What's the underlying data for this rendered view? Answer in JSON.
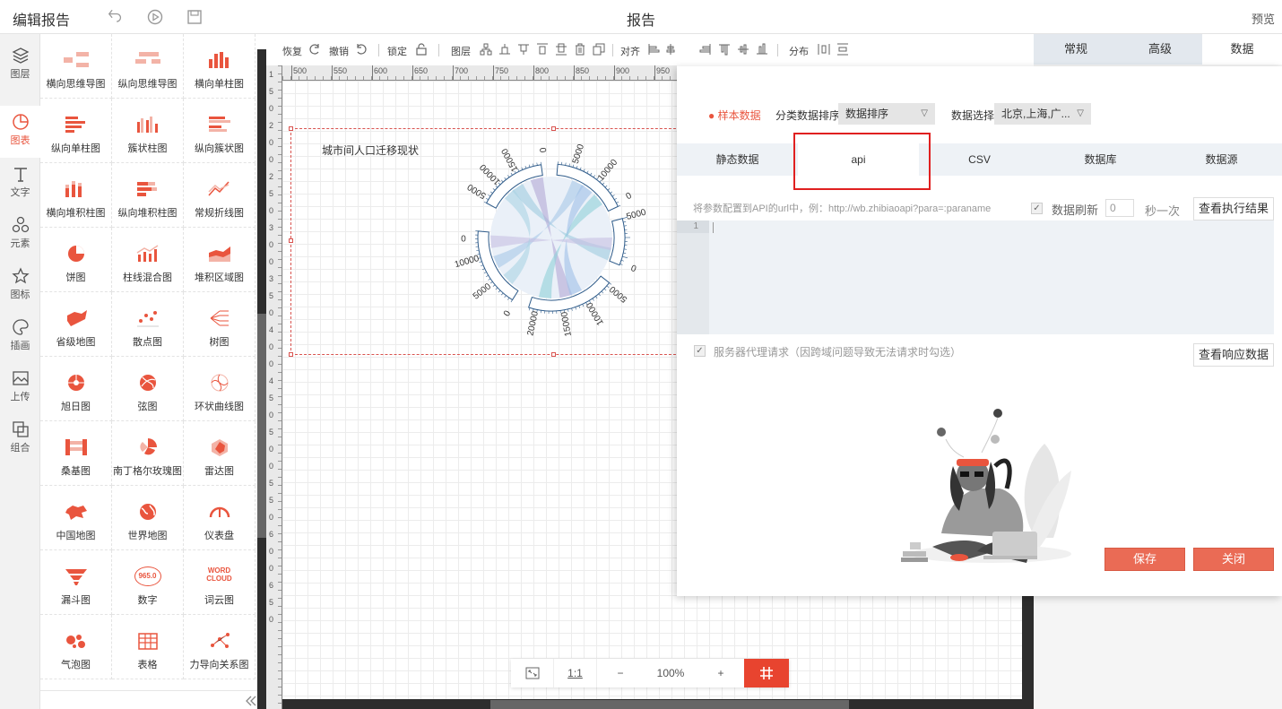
{
  "topbar": {
    "app_title": "编辑报告",
    "page_title": "报告",
    "preview": "预览"
  },
  "rail": [
    {
      "label": "图层",
      "icon": "layers-icon"
    },
    {
      "label": "图表",
      "icon": "chart-clock-icon",
      "active": true
    },
    {
      "label": "文字",
      "icon": "text-icon"
    },
    {
      "label": "元素",
      "icon": "shapes-icon"
    },
    {
      "label": "图标",
      "icon": "star-icon"
    },
    {
      "label": "插画",
      "icon": "palette-icon"
    },
    {
      "label": "上传",
      "icon": "image-upload-icon"
    },
    {
      "label": "组合",
      "icon": "group-icon"
    }
  ],
  "palette": [
    "横向思维导图",
    "纵向思维导图",
    "横向单柱图",
    "纵向单柱图",
    "簇状柱图",
    "纵向簇状图",
    "横向堆积柱图",
    "纵向堆积柱图",
    "常规折线图",
    "饼图",
    "柱线混合图",
    "堆积区域图",
    "省级地图",
    "散点图",
    "树图",
    "旭日图",
    "弦图",
    "环状曲线图",
    "桑基图",
    "南丁格尔玫瑰图",
    "雷达图",
    "中国地图",
    "世界地图",
    "仪表盘",
    "漏斗图",
    "数字",
    "词云图",
    "气泡图",
    "表格",
    "力导向关系图"
  ],
  "palette_misc": {
    "number_glyph": "965.0",
    "wordcloud_top": "WORD",
    "wordcloud_bottom": "CLOUD"
  },
  "toolbar": {
    "redo": "恢复",
    "undo": "撤销",
    "lock": "锁定",
    "layer": "图层",
    "align": "对齐",
    "distribute": "分布"
  },
  "ruler_h": [
    "500",
    "550",
    "600",
    "650",
    "700",
    "750",
    "800",
    "850",
    "900",
    "950"
  ],
  "ruler_v": [
    "1",
    "5",
    "0",
    "2",
    "0",
    "0",
    "2",
    "5",
    "0",
    "3",
    "0",
    "0",
    "3",
    "5",
    "0",
    "4",
    "0",
    "0",
    "4",
    "5",
    "0",
    "5",
    "0",
    "0",
    "5",
    "5",
    "0",
    "6",
    "0",
    "0",
    "6",
    "5",
    "0"
  ],
  "widget": {
    "title": "城市间人口迁移现状"
  },
  "chord_labels": [
    {
      "t": "15000"
    },
    {
      "t": "10000"
    },
    {
      "t": "5000"
    },
    {
      "t": "0"
    },
    {
      "t": "5000"
    },
    {
      "t": "10000"
    },
    {
      "t": "0"
    },
    {
      "t": "5000"
    },
    {
      "t": "0"
    },
    {
      "t": "5000"
    },
    {
      "t": "10000"
    },
    {
      "t": "15000"
    },
    {
      "t": "20000"
    },
    {
      "t": "0"
    },
    {
      "t": "5000"
    },
    {
      "t": "10000"
    },
    {
      "t": "0"
    }
  ],
  "zoombar": {
    "ratio": "1:1",
    "minus": "−",
    "zoom": "100%",
    "plus": "+"
  },
  "right_tabs": [
    {
      "label": "常规"
    },
    {
      "label": "高级"
    },
    {
      "label": "数据",
      "active": true
    }
  ],
  "data_panel": {
    "sample": "样本数据",
    "sort_label": "分类数据排序",
    "sort_value": "数据排序",
    "select_label": "数据选择",
    "select_value": "北京,上海,广...",
    "subtabs": [
      {
        "label": "静态数据"
      },
      {
        "label": "api",
        "active": true
      },
      {
        "label": "CSV"
      },
      {
        "label": "数据库"
      },
      {
        "label": "数据源"
      }
    ],
    "hint": "将参数配置到API的url中，例：http://wb.zhibiaoapi?para=:paraname",
    "refresh_label": "数据刷新",
    "refresh_value": "0",
    "refresh_unit": "秒一次",
    "run_btn": "查看执行结果",
    "line_no": "1",
    "proxy_label": "服务器代理请求（因跨域问题导致无法请求时勾选）",
    "response_btn": "查看响应数据",
    "save_btn": "保存",
    "close_btn": "关闭"
  }
}
